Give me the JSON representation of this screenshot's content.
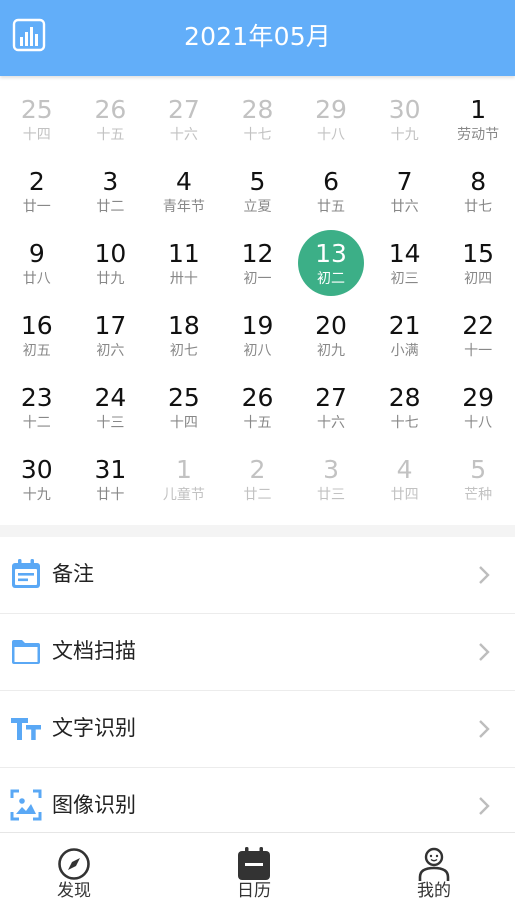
{
  "header": {
    "title": "2021年05月",
    "stats_icon": "bar-chart-icon",
    "bg_color": "#62aef9"
  },
  "calendar": {
    "selected_color": "#3caf87",
    "rows": [
      [
        {
          "num": "25",
          "lunar": "十四",
          "other": true
        },
        {
          "num": "26",
          "lunar": "十五",
          "other": true
        },
        {
          "num": "27",
          "lunar": "十六",
          "other": true
        },
        {
          "num": "28",
          "lunar": "十七",
          "other": true
        },
        {
          "num": "29",
          "lunar": "十八",
          "other": true
        },
        {
          "num": "30",
          "lunar": "十九",
          "other": true
        },
        {
          "num": "1",
          "lunar": "劳动节",
          "other": false
        }
      ],
      [
        {
          "num": "2",
          "lunar": "廿一",
          "other": false
        },
        {
          "num": "3",
          "lunar": "廿二",
          "other": false
        },
        {
          "num": "4",
          "lunar": "青年节",
          "other": false
        },
        {
          "num": "5",
          "lunar": "立夏",
          "other": false
        },
        {
          "num": "6",
          "lunar": "廿五",
          "other": false
        },
        {
          "num": "7",
          "lunar": "廿六",
          "other": false
        },
        {
          "num": "8",
          "lunar": "廿七",
          "other": false
        }
      ],
      [
        {
          "num": "9",
          "lunar": "廿八",
          "other": false
        },
        {
          "num": "10",
          "lunar": "廿九",
          "other": false
        },
        {
          "num": "11",
          "lunar": "卅十",
          "other": false
        },
        {
          "num": "12",
          "lunar": "初一",
          "other": false
        },
        {
          "num": "13",
          "lunar": "初二",
          "other": false,
          "selected": true
        },
        {
          "num": "14",
          "lunar": "初三",
          "other": false
        },
        {
          "num": "15",
          "lunar": "初四",
          "other": false
        }
      ],
      [
        {
          "num": "16",
          "lunar": "初五",
          "other": false
        },
        {
          "num": "17",
          "lunar": "初六",
          "other": false
        },
        {
          "num": "18",
          "lunar": "初七",
          "other": false
        },
        {
          "num": "19",
          "lunar": "初八",
          "other": false
        },
        {
          "num": "20",
          "lunar": "初九",
          "other": false
        },
        {
          "num": "21",
          "lunar": "小满",
          "other": false
        },
        {
          "num": "22",
          "lunar": "十一",
          "other": false
        }
      ],
      [
        {
          "num": "23",
          "lunar": "十二",
          "other": false
        },
        {
          "num": "24",
          "lunar": "十三",
          "other": false
        },
        {
          "num": "25",
          "lunar": "十四",
          "other": false
        },
        {
          "num": "26",
          "lunar": "十五",
          "other": false
        },
        {
          "num": "27",
          "lunar": "十六",
          "other": false
        },
        {
          "num": "28",
          "lunar": "十七",
          "other": false
        },
        {
          "num": "29",
          "lunar": "十八",
          "other": false
        }
      ],
      [
        {
          "num": "30",
          "lunar": "十九",
          "other": false
        },
        {
          "num": "31",
          "lunar": "廿十",
          "other": false
        },
        {
          "num": "1",
          "lunar": "儿童节",
          "other": true
        },
        {
          "num": "2",
          "lunar": "廿二",
          "other": true
        },
        {
          "num": "3",
          "lunar": "廿三",
          "other": true
        },
        {
          "num": "4",
          "lunar": "廿四",
          "other": true
        },
        {
          "num": "5",
          "lunar": "芒种",
          "other": true
        }
      ]
    ]
  },
  "menu": [
    {
      "label": "备注",
      "icon": "notes-calendar-icon"
    },
    {
      "label": "文档扫描",
      "icon": "folder-icon"
    },
    {
      "label": "文字识别",
      "icon": "text-recognition-icon"
    },
    {
      "label": "图像识别",
      "icon": "image-recognition-icon"
    }
  ],
  "tabs": [
    {
      "label": "发现",
      "icon": "compass-icon"
    },
    {
      "label": "日历",
      "icon": "calendar-icon",
      "active": true
    },
    {
      "label": "我的",
      "icon": "user-icon"
    }
  ],
  "colors": {
    "icon_blue": "#5aa8f5",
    "chevron": "#bdbdbd"
  }
}
